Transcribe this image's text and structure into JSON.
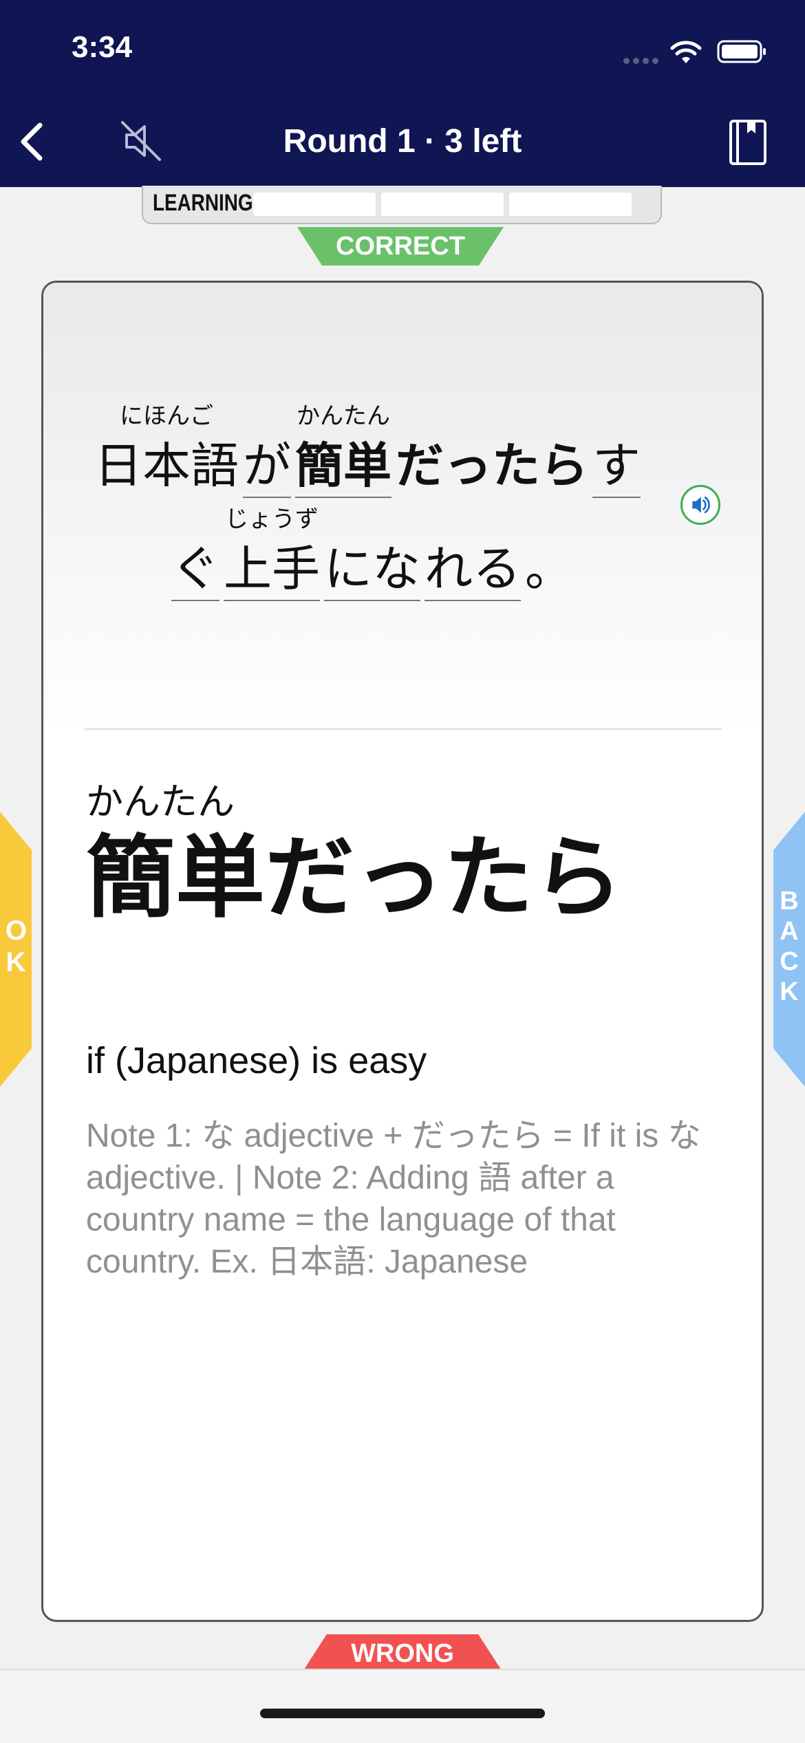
{
  "status_bar": {
    "time": "3:34"
  },
  "nav": {
    "title": "Round 1 · 3 left"
  },
  "progress": {
    "label": "LEARNING"
  },
  "tabs": {
    "correct": "CORRECT",
    "wrong": "WRONG",
    "ok": "OK",
    "back": "BACK"
  },
  "sentence": {
    "line1": [
      {
        "text": "日本語",
        "ruby": "にほんご",
        "underline": false,
        "bold": false
      },
      {
        "text": "が",
        "ruby": "",
        "underline": true,
        "bold": false
      },
      {
        "text": "簡単",
        "ruby": "かんたん",
        "underline": true,
        "bold": true
      },
      {
        "text": "だったら",
        "ruby": "",
        "underline": false,
        "bold": true
      },
      {
        "text": "す",
        "ruby": "",
        "underline": true,
        "bold": false
      }
    ],
    "line2": [
      {
        "text": "ぐ",
        "ruby": "",
        "underline": true,
        "bold": false
      },
      {
        "text": "上手",
        "ruby": "じょうず",
        "underline": true,
        "bold": false
      },
      {
        "text": "にな",
        "ruby": "",
        "underline": true,
        "bold": false
      },
      {
        "text": "れる",
        "ruby": "",
        "underline": true,
        "bold": false
      },
      {
        "text": "。",
        "ruby": "",
        "underline": false,
        "bold": false
      }
    ]
  },
  "term": {
    "reading": "かんたん",
    "text": "簡単だったら"
  },
  "meaning": "if (Japanese) is easy",
  "note": "Note 1: な adjective + だったら = If it is な adjective. | Note 2: Adding 語 after a country name = the language of that country. Ex. 日本語: Japanese",
  "colors": {
    "header": "#0f1653",
    "correct": "#6ac16a",
    "wrong": "#f15151",
    "ok": "#f9c93c",
    "back": "#8ec3f3",
    "audio": "#3cae53"
  },
  "icons": [
    "back-chevron-icon",
    "mute-icon",
    "book-icon",
    "speaker-icon",
    "wifi-icon",
    "battery-icon"
  ]
}
